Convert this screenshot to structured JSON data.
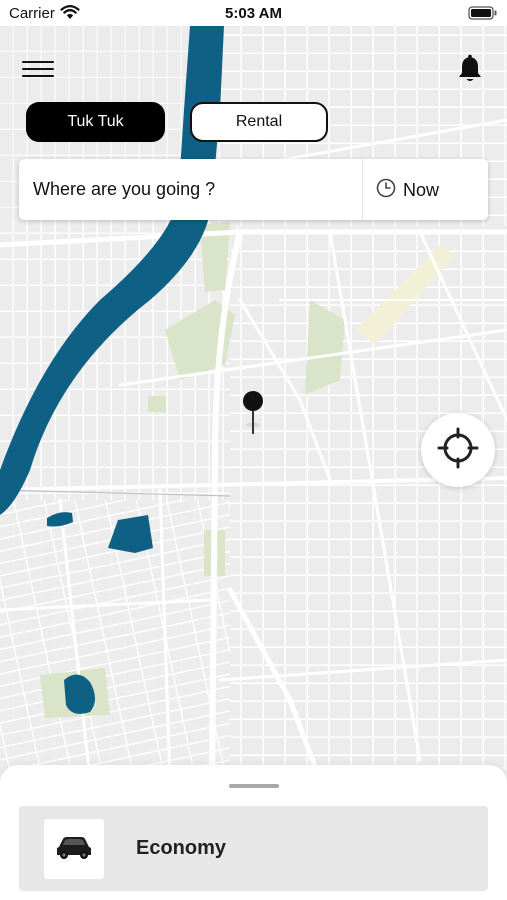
{
  "status_bar": {
    "carrier": "Carrier",
    "time": "5:03 AM"
  },
  "header": {
    "menu_icon": "hamburger-menu-icon",
    "notification_icon": "bell-icon"
  },
  "mode_tabs": [
    {
      "label": "Tuk Tuk",
      "active": true
    },
    {
      "label": "Rental",
      "active": false
    }
  ],
  "search": {
    "placeholder": "Where are you going ?",
    "time_label": "Now",
    "time_icon": "clock-icon"
  },
  "map": {
    "pin_icon": "location-pin-icon",
    "locate_icon": "crosshair-icon",
    "colors": {
      "water": "#0e6184",
      "land": "#ececec",
      "road": "#ffffff",
      "park": "#d9e4c8",
      "highlight": "#f2f1d8"
    }
  },
  "bottom_sheet": {
    "options": [
      {
        "name": "Economy",
        "icon": "car-icon"
      }
    ]
  }
}
